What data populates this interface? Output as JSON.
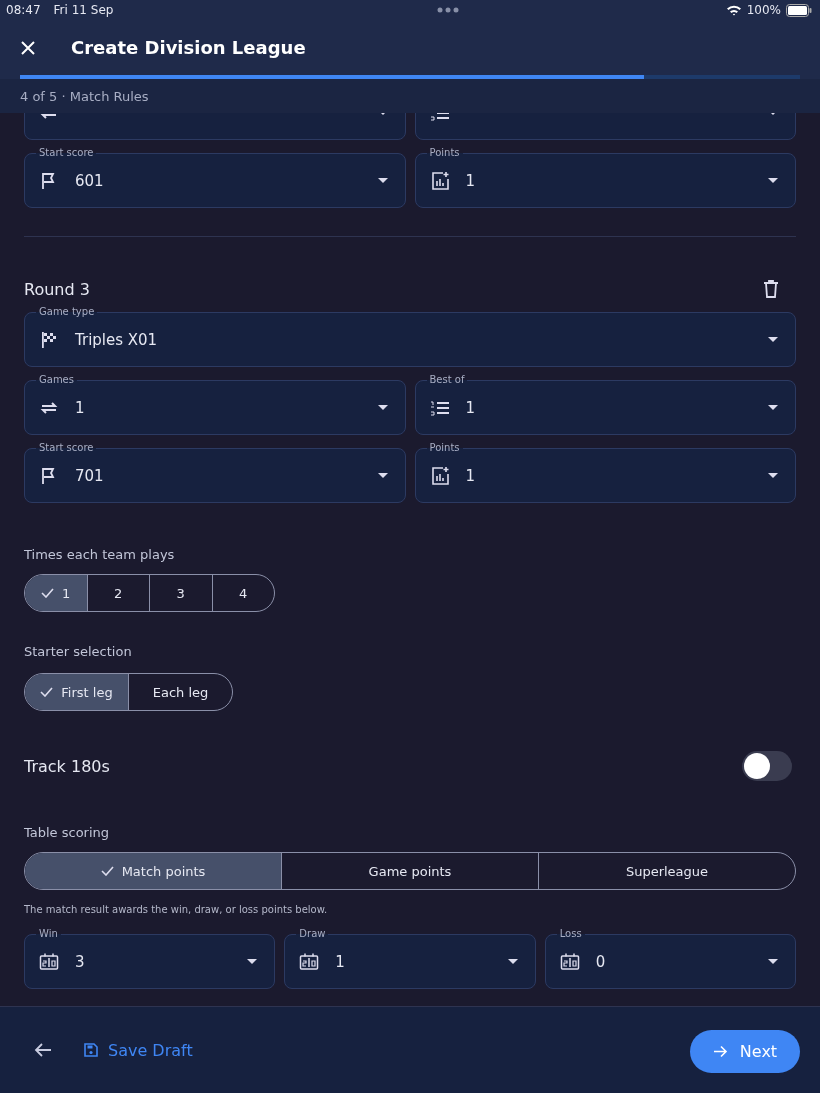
{
  "status_bar": {
    "time": "08:47",
    "date": "Fri 11 Sep",
    "battery": "100%"
  },
  "header": {
    "title": "Create Division League",
    "progress": {
      "level": 0.8
    },
    "step": "4 of 5 · Match Rules"
  },
  "previous_round": {
    "partial_fields": [
      {
        "kind": "repeat"
      },
      {
        "kind": "list"
      }
    ],
    "fields": [
      {
        "label": "Start score",
        "kind": "flag",
        "value": "601"
      },
      {
        "label": "Points",
        "kind": "chart",
        "value": "1"
      }
    ]
  },
  "round": {
    "title": "Round 3",
    "game_type": {
      "label": "Game type",
      "kind": "checkered",
      "value": "Triples X01"
    },
    "fields": [
      {
        "label": "Games",
        "kind": "repeat",
        "value": "1"
      },
      {
        "label": "Best of",
        "kind": "list",
        "value": "1"
      },
      {
        "label": "Start score",
        "kind": "flag",
        "value": "701"
      },
      {
        "label": "Points",
        "kind": "chart",
        "value": "1"
      }
    ]
  },
  "times_each_team_plays": {
    "label": "Times each team plays",
    "options": [
      {
        "label": "1",
        "selected": true
      },
      {
        "label": "2",
        "selected": false
      },
      {
        "label": "3",
        "selected": false
      },
      {
        "label": "4",
        "selected": false
      }
    ]
  },
  "starter_selection": {
    "label": "Starter selection",
    "options": [
      {
        "label": "First leg",
        "selected": true
      },
      {
        "label": "Each leg",
        "selected": false
      }
    ]
  },
  "track_180s": {
    "label": "Track 180s",
    "on": false
  },
  "table_scoring": {
    "label": "Table scoring",
    "options": [
      {
        "label": "Match points",
        "selected": true
      },
      {
        "label": "Game points",
        "selected": false
      },
      {
        "label": "Superleague",
        "selected": false
      }
    ],
    "note": "The match result awards the win, draw, or loss points below.",
    "fields": [
      {
        "label": "Win",
        "kind": "scoreboard",
        "value": "3"
      },
      {
        "label": "Draw",
        "kind": "scoreboard",
        "value": "1"
      },
      {
        "label": "Loss",
        "kind": "scoreboard",
        "value": "0"
      }
    ]
  },
  "footer": {
    "save_draft": "Save Draft",
    "next": "Next"
  }
}
